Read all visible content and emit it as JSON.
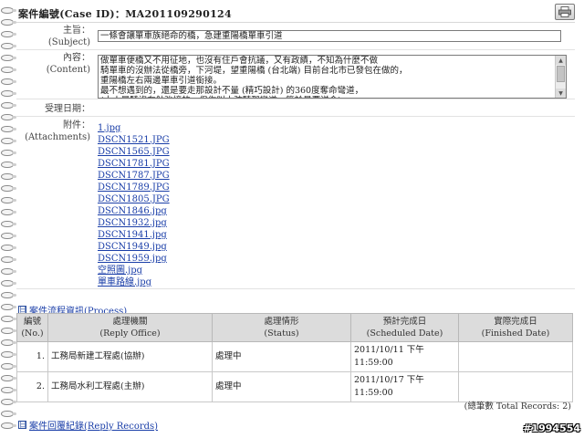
{
  "header": {
    "title": "案件編號(Case ID)：MA201109290124"
  },
  "form": {
    "subject_label_zh": "主旨：",
    "subject_label_en": "(Subject)",
    "subject_value": "一條會讓單車族絕命的橋，急建重陽橋單車引道",
    "content_label_zh": "內容：",
    "content_label_en": "(Content)",
    "content_lines": [
      "做單車便橋又不用征地，也沒有住戶會抗議，又有政績，不知為什麼不做",
      "騎單車的沒辦法從橋旁，下河堤，望重陽橋 (台北端) 目前台北市已發包在做的，",
      "重陽橋左右兩邊單車引道銜接。",
      "最不想遇到的，還是要走那設計不量 (精巧設計) 的360度奪命彎道，",
      "(大人是騎沒有勉強撞的，但你叫小孩騎那彎道，簡於是要送命)"
    ],
    "date_label_zh": "受理日期：",
    "attach_label_zh": "附件：",
    "attach_label_en": "(Attachments)",
    "attachments": [
      "1.jpg",
      "DSCN1521.JPG",
      "DSCN1565.JPG",
      "DSCN1781.JPG",
      "DSCN1787.JPG",
      "DSCN1789.JPG",
      "DSCN1805.JPG",
      "DSCN1846.jpg",
      "DSCN1932.jpg",
      "DSCN1941.jpg",
      "DSCN1949.jpg",
      "DSCN1959.jpg",
      "空照圖.jpg",
      "單車路線.jpg"
    ]
  },
  "process": {
    "toggle": "日",
    "title": "案件流程資訊(Process)",
    "headers": {
      "no_zh": "編號",
      "no_en": "(No.)",
      "office_zh": "處理機關",
      "office_en": "(Reply Office)",
      "status_zh": "處理情形",
      "status_en": "(Status)",
      "sched_zh": "預計完成日",
      "sched_en": "(Scheduled Date)",
      "fin_zh": "實際完成日",
      "fin_en": "(Finished Date)"
    },
    "rows": [
      {
        "no": "1.",
        "office": "工務局新建工程處(協辦)",
        "status": "處理中",
        "sched_1": "2011/10/11 下午",
        "sched_2": "11:59:00",
        "finished": ""
      },
      {
        "no": "2.",
        "office": "工務局水利工程處(主辦)",
        "status": "處理中",
        "sched_1": "2011/10/17 下午",
        "sched_2": "11:59:00",
        "finished": ""
      }
    ],
    "total": "(總筆數 Total Records: 2)"
  },
  "reply": {
    "toggle": "日",
    "title": "案件回覆紀錄(Reply Records)"
  },
  "badge": "#1994554",
  "icons": {
    "print": "printer-icon",
    "toggle": "collapse-icon"
  }
}
